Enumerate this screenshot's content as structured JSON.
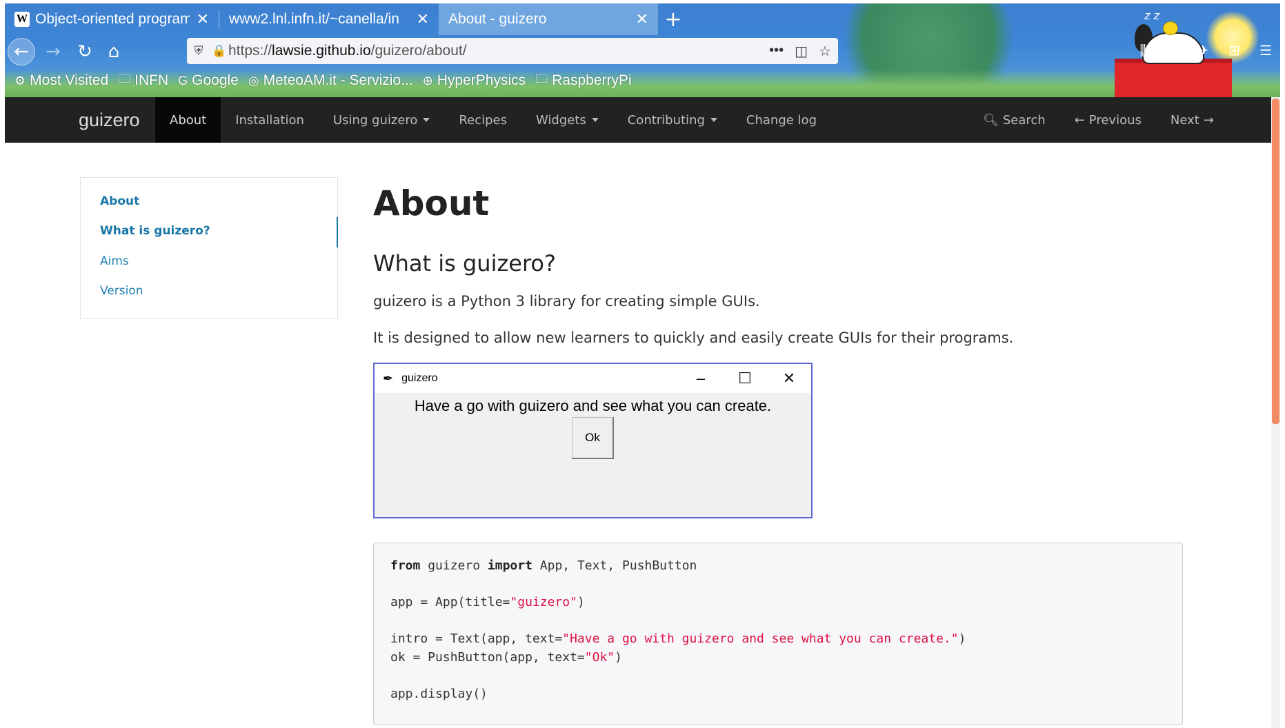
{
  "browser": {
    "tabs": [
      {
        "label": "Object-oriented program",
        "favicon": "W",
        "active": false
      },
      {
        "label": "www2.lnl.infn.it/~canella/in",
        "active": false
      },
      {
        "label": "About - guizero",
        "active": true
      }
    ],
    "new_tab": "+",
    "url_prefix": "https://",
    "url_host": "lawsie.github.io",
    "url_path": "/guizero/about/",
    "bookmarks": [
      {
        "label": "Most Visited",
        "icon": "gear-icon"
      },
      {
        "label": "INFN",
        "icon": "folder-icon"
      },
      {
        "label": "Google",
        "icon": "google-icon"
      },
      {
        "label": "MeteoAM.it - Servizio...",
        "icon": "meteo-icon"
      },
      {
        "label": "HyperPhysics",
        "icon": "globe-icon"
      },
      {
        "label": "RaspberryPi",
        "icon": "folder-icon"
      }
    ],
    "theme_zz": "z z"
  },
  "site": {
    "brand": "guizero",
    "nav": [
      {
        "label": "About",
        "active": true,
        "caret": false
      },
      {
        "label": "Installation",
        "active": false,
        "caret": false
      },
      {
        "label": "Using guizero",
        "active": false,
        "caret": true
      },
      {
        "label": "Recipes",
        "active": false,
        "caret": false
      },
      {
        "label": "Widgets",
        "active": false,
        "caret": true
      },
      {
        "label": "Contributing",
        "active": false,
        "caret": true
      },
      {
        "label": "Change log",
        "active": false,
        "caret": false
      }
    ],
    "nav_right": {
      "search": "Search",
      "previous": "Previous",
      "next": "Next"
    }
  },
  "sidebar": {
    "items": [
      {
        "label": "About",
        "bold": true
      },
      {
        "label": "What is guizero?",
        "bold": true,
        "active": true
      },
      {
        "label": "Aims",
        "bold": false
      },
      {
        "label": "Version",
        "bold": false
      }
    ]
  },
  "content": {
    "title": "About",
    "section_title": "What is guizero?",
    "para1": "guizero is a Python 3 library for creating simple GUIs.",
    "para2": "It is designed to allow new learners to quickly and easily create GUIs for their programs."
  },
  "app_window": {
    "title": "guizero",
    "text": "Have a go with guizero and see what you can create.",
    "button": "Ok"
  },
  "code": {
    "line1": {
      "kw1": "from",
      "mid": " guizero ",
      "kw2": "import",
      "rest": " App, Text, PushButton"
    },
    "line2": {
      "pre": "app = App(title=",
      "str": "\"guizero\"",
      "post": ")"
    },
    "line3": {
      "pre": "intro = Text(app, text=",
      "str": "\"Have a go with guizero and see what you can create.\"",
      "post": ")"
    },
    "line4": {
      "pre": "ok = PushButton(app, text=",
      "str": "\"Ok\"",
      "post": ")"
    },
    "line5": "app.display()"
  },
  "colors": {
    "navbar_bg": "#222222",
    "link": "#1977a8",
    "string": "#dd1144",
    "scroll_thumb": "#f28a63"
  }
}
